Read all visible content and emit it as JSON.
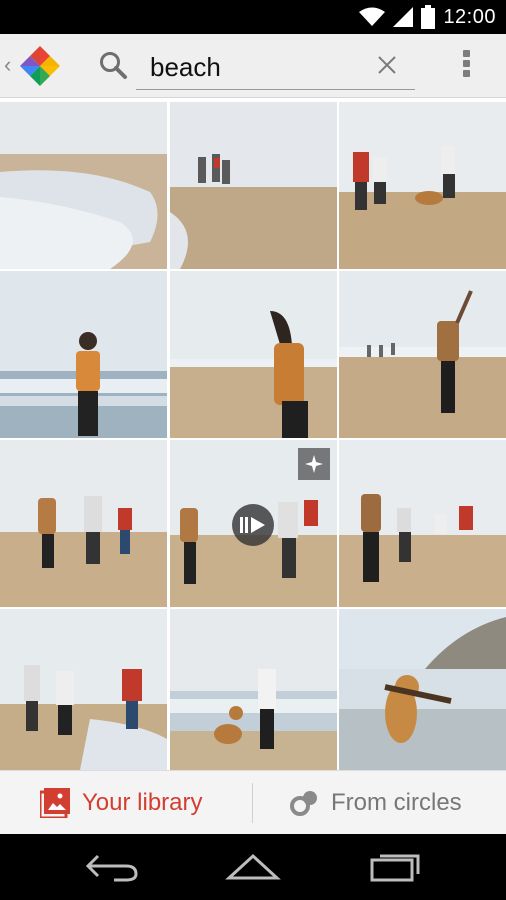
{
  "status_bar": {
    "time": "12:00"
  },
  "search": {
    "query": "beach"
  },
  "tabs": [
    {
      "label": "Your library",
      "icon": "photo-library-icon",
      "active": true
    },
    {
      "label": "From circles",
      "icon": "circles-icon",
      "active": false
    }
  ],
  "colors": {
    "accent": "#d23f31",
    "action_bar": "#efefef",
    "status_bar": "#000000"
  },
  "photo_badges": {
    "auto_awesome": "auto-awesome-icon",
    "video": "video-play-icon"
  }
}
